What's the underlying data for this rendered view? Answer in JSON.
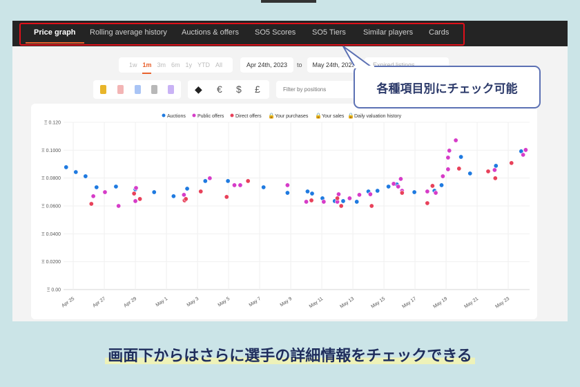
{
  "tabs": [
    {
      "label": "Price graph",
      "active": true
    },
    {
      "label": "Rolling average history"
    },
    {
      "label": "Auctions & offers"
    },
    {
      "label": "SO5 Scores"
    },
    {
      "label": "SO5 Tiers"
    },
    {
      "label": "Similar players"
    },
    {
      "label": "Cards"
    }
  ],
  "periods": {
    "options": [
      "1w",
      "1m",
      "3m",
      "6m",
      "1y",
      "YTD",
      "All"
    ],
    "selected": "1m"
  },
  "date_range": {
    "from": "Apr 24th, 2023",
    "to_label": "to",
    "to": "May 24th, 2023"
  },
  "expired_listings_label": "Expired listings",
  "rarity_colors": [
    "#e8b52a",
    "#f3b5b5",
    "#a9c4f5",
    "#b8b8b8",
    "#c9b3f5"
  ],
  "currencies": [
    "ETH",
    "€",
    "$",
    "£"
  ],
  "position_filter": {
    "placeholder": "Filter by positions"
  },
  "callout": "各種項目別にチェック可能",
  "caption": "画面下からはさらに選手の詳細情報をチェックできる",
  "colors": {
    "accent": "#e8612c",
    "auctions": "#1f7ae0",
    "public_offers": "#d63cc8",
    "direct_offers": "#e8415a",
    "highlight_box": "#e0101a"
  },
  "chart_data": {
    "type": "scatter",
    "legend": [
      "Auctions",
      "Public offers",
      "Direct offers",
      "Your purchases",
      "Your sales",
      "Daily valuation history"
    ],
    "legend_placement": "top",
    "y_tick_labels": [
      "Ξ 0.00",
      "Ξ 0.0200",
      "Ξ 0.0400",
      "Ξ 0.0600",
      "Ξ 0.0800",
      "Ξ 0.1000",
      "Ξ 0.120"
    ],
    "ylim": [
      0,
      0.12
    ],
    "x_tick_labels": [
      "Apr 25",
      "Apr 27",
      "Apr 29",
      "May 1",
      "May 3",
      "May 5",
      "May 7",
      "May 9",
      "May 11",
      "May 13",
      "May 15",
      "May 17",
      "May 19",
      "May 21",
      "May 23"
    ],
    "xlim": [
      "2023-04-24T09:00",
      "2023-05-24T09:00"
    ],
    "grid": true,
    "series": [
      {
        "name": "Auctions",
        "points": [
          [
            "2023-04-24T13:00",
            0.0878
          ],
          [
            "2023-04-25T04:00",
            0.0843
          ],
          [
            "2023-04-25T19:00",
            0.0813
          ],
          [
            "2023-04-26T12:00",
            0.0734
          ],
          [
            "2023-04-27T18:00",
            0.0739
          ],
          [
            "2023-04-29T00:00",
            0.0719
          ],
          [
            "2023-04-30T05:00",
            0.0699
          ],
          [
            "2023-05-01T11:00",
            0.067
          ],
          [
            "2023-05-02T08:00",
            0.0724
          ],
          [
            "2023-05-03T12:00",
            0.0779
          ],
          [
            "2023-05-04T23:00",
            0.0779
          ],
          [
            "2023-05-07T06:00",
            0.0734
          ],
          [
            "2023-05-08T19:00",
            0.0694
          ],
          [
            "2023-05-10T02:00",
            0.0704
          ],
          [
            "2023-05-10T09:00",
            0.0689
          ],
          [
            "2023-05-11T01:00",
            0.0655
          ],
          [
            "2023-05-11T20:00",
            0.0635
          ],
          [
            "2023-05-12T09:00",
            0.0635
          ],
          [
            "2023-05-13T06:00",
            0.063
          ],
          [
            "2023-05-14T00:00",
            0.0704
          ],
          [
            "2023-05-14T14:00",
            0.0709
          ],
          [
            "2023-05-15T07:00",
            0.0739
          ],
          [
            "2023-05-15T20:00",
            0.0754
          ],
          [
            "2023-05-16T23:00",
            0.0699
          ],
          [
            "2023-05-18T06:00",
            0.0709
          ],
          [
            "2023-05-18T17:00",
            0.0749
          ],
          [
            "2023-05-19T23:00",
            0.0952
          ],
          [
            "2023-05-20T13:00",
            0.0833
          ],
          [
            "2023-05-22T05:00",
            0.0888
          ],
          [
            "2023-05-23T20:00",
            0.0992
          ]
        ]
      },
      {
        "name": "Public offers",
        "points": [
          [
            "2023-04-26T07:00",
            0.067
          ],
          [
            "2023-04-27T01:00",
            0.0699
          ],
          [
            "2023-04-27T22:00",
            0.06
          ],
          [
            "2023-04-29T01:00",
            0.0729
          ],
          [
            "2023-04-29T00:00",
            0.0635
          ],
          [
            "2023-05-02T03:00",
            0.068
          ],
          [
            "2023-05-03T19:00",
            0.0799
          ],
          [
            "2023-05-05T09:00",
            0.0749
          ],
          [
            "2023-05-05T18:00",
            0.0749
          ],
          [
            "2023-05-08T19:00",
            0.0749
          ],
          [
            "2023-05-10T00:00",
            0.063
          ],
          [
            "2023-05-11T03:00",
            0.063
          ],
          [
            "2023-05-12T02:00",
            0.0684
          ],
          [
            "2023-05-12T00:00",
            0.063
          ],
          [
            "2023-05-12T19:00",
            0.0655
          ],
          [
            "2023-05-13T10:00",
            0.068
          ],
          [
            "2023-05-14T03:00",
            0.0684
          ],
          [
            "2023-05-15T15:00",
            0.0759
          ],
          [
            "2023-05-16T02:00",
            0.0794
          ],
          [
            "2023-05-15T22:00",
            0.0739
          ],
          [
            "2023-05-16T04:00",
            0.0709
          ],
          [
            "2023-05-17T19:00",
            0.0704
          ],
          [
            "2023-05-18T08:00",
            0.0694
          ],
          [
            "2023-05-18T19:00",
            0.0813
          ],
          [
            "2023-05-19T03:00",
            0.0863
          ],
          [
            "2023-05-19T03:00",
            0.0947
          ],
          [
            "2023-05-19T05:00",
            0.0997
          ],
          [
            "2023-05-19T15:00",
            0.1071
          ],
          [
            "2023-05-22T03:00",
            0.0858
          ],
          [
            "2023-05-23T23:00",
            0.0967
          ],
          [
            "2023-05-24T03:00",
            0.1002
          ]
        ]
      },
      {
        "name": "Direct offers",
        "points": [
          [
            "2023-04-26T04:00",
            0.0615
          ],
          [
            "2023-04-28T22:00",
            0.0689
          ],
          [
            "2023-04-29T07:00",
            0.065
          ],
          [
            "2023-05-02T04:00",
            0.064
          ],
          [
            "2023-05-02T06:00",
            0.065
          ],
          [
            "2023-05-03T05:00",
            0.0704
          ],
          [
            "2023-05-04T21:00",
            0.0665
          ],
          [
            "2023-05-06T06:00",
            0.0779
          ],
          [
            "2023-05-10T08:00",
            0.064
          ],
          [
            "2023-05-12T00:00",
            0.0655
          ],
          [
            "2023-05-12T06:00",
            0.06
          ],
          [
            "2023-05-14T05:00",
            0.06
          ],
          [
            "2023-05-16T04:00",
            0.0694
          ],
          [
            "2023-05-17T19:00",
            0.062
          ],
          [
            "2023-05-18T03:00",
            0.0744
          ],
          [
            "2023-05-19T20:00",
            0.0868
          ],
          [
            "2023-05-21T17:00",
            0.0848
          ],
          [
            "2023-05-22T04:00",
            0.0799
          ],
          [
            "2023-05-23T05:00",
            0.0908
          ]
        ]
      }
    ]
  }
}
